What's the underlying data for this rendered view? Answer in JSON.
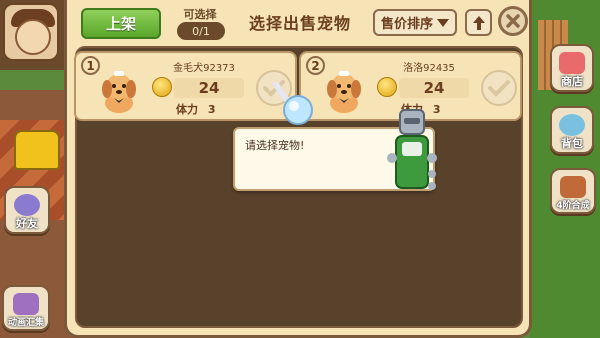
{
  "header": {
    "list_button": "上架",
    "select_label": "可选择",
    "select_count": "0/1",
    "title": "选择出售宠物",
    "sort_label": "售价排序"
  },
  "pets": [
    {
      "index": "1",
      "name": "金毛犬92373",
      "price": "24",
      "stamina_label": "体力",
      "stamina_value": "3"
    },
    {
      "index": "2",
      "name": "洛洛92435",
      "price": "24",
      "stamina_label": "体力",
      "stamina_value": "3"
    }
  ],
  "tooltip": {
    "text": "请选择宠物!"
  },
  "side": {
    "shop": "商店",
    "bag": "背包",
    "synth": "4阶合成",
    "friend": "好友",
    "dye": "动画汇集"
  },
  "colors": {
    "panel_bg": "#f6e3b6",
    "panel_dark": "#59422c",
    "button_green": "#5aa62a",
    "text_brown": "#6a3e1e"
  }
}
